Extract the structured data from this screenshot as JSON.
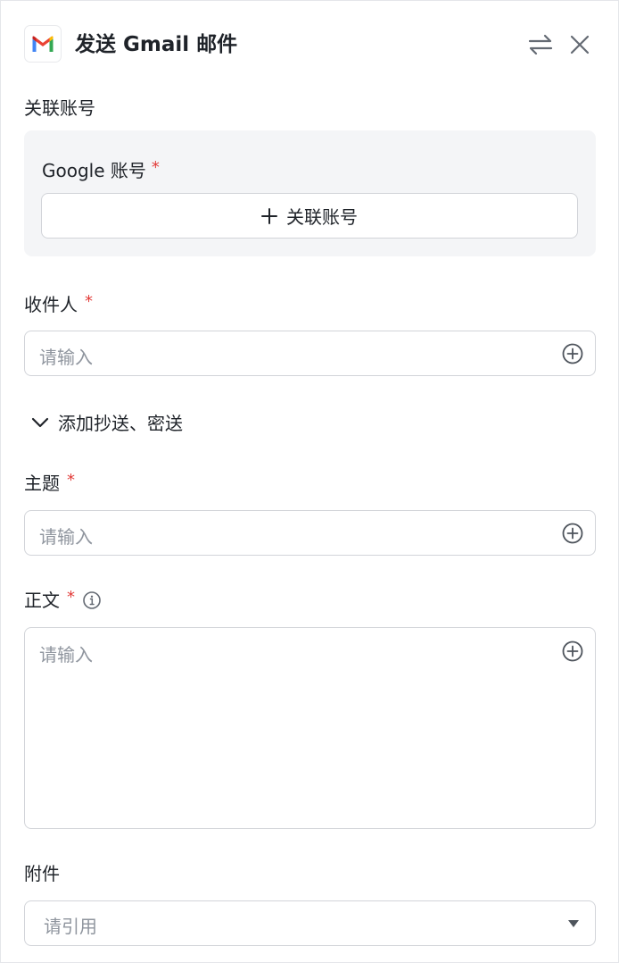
{
  "header": {
    "title": "发送 Gmail 邮件",
    "logo_icon": "gmail-logo-icon",
    "swap_icon": "swap-arrows-icon",
    "close_icon": "close-icon"
  },
  "account": {
    "section_label": "关联账号",
    "field_label": "Google 账号",
    "required_mark": "*",
    "link_button_label": "关联账号"
  },
  "recipient": {
    "label": "收件人",
    "required_mark": "*",
    "placeholder": "请输入"
  },
  "cc_toggle": {
    "label": "添加抄送、密送"
  },
  "subject": {
    "label": "主题",
    "required_mark": "*",
    "placeholder": "请输入"
  },
  "body": {
    "label": "正文",
    "required_mark": "*",
    "placeholder": "请输入"
  },
  "attachment": {
    "label": "附件",
    "placeholder": "请引用"
  },
  "colors": {
    "required": "#e23c39",
    "border": "#d2d4d9",
    "placeholder": "#8f959e",
    "section_bg": "#f4f5f7"
  }
}
